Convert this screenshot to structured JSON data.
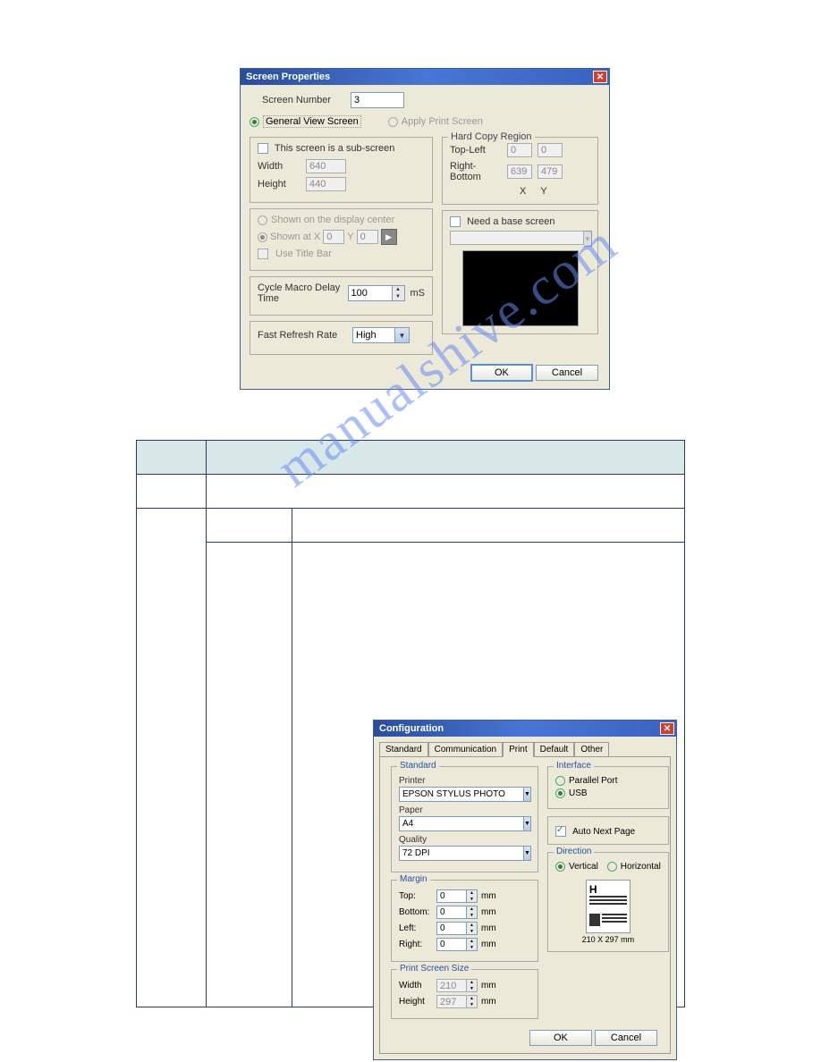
{
  "dialog1": {
    "title": "Screen Properties",
    "screen_number_label": "Screen Number",
    "screen_number_value": "3",
    "radio_general": "General View Screen",
    "radio_apply": "Apply Print Screen",
    "sub_screen_label": "This screen is a sub-screen",
    "width_label": "Width",
    "width_value": "640",
    "height_label": "Height",
    "height_value": "440",
    "shown_center_label": "Shown on the display center",
    "shown_at_label": "Shown at",
    "shown_x_label": "X",
    "shown_x_value": "0",
    "shown_y_label": "Y",
    "shown_y_value": "0",
    "use_titlebar_label": "Use Title Bar",
    "cycle_macro_label": "Cycle Macro Delay Time",
    "cycle_macro_value": "100",
    "cycle_macro_unit": "mS",
    "fast_refresh_label": "Fast Refresh Rate",
    "fast_refresh_value": "High",
    "hard_copy_legend": "Hard Copy Region",
    "top_left_label": "Top-Left",
    "top_left_x": "0",
    "top_left_y": "0",
    "right_bottom_label": "Right-Bottom",
    "right_bottom_x": "639",
    "right_bottom_y": "479",
    "x_hdr": "X",
    "y_hdr": "Y",
    "need_base_label": "Need a base screen",
    "ok": "OK",
    "cancel": "Cancel"
  },
  "dialog2": {
    "title": "Configuration",
    "tabs": [
      "Standard",
      "Communication",
      "Print",
      "Default",
      "Other"
    ],
    "standard_legend": "Standard",
    "printer_label": "Printer",
    "printer_value": "EPSON STYLUS PHOTO",
    "paper_label": "Paper",
    "paper_value": "A4",
    "quality_label": "Quality",
    "quality_value": "72 DPI",
    "margin_legend": "Margin",
    "top_label": "Top:",
    "bottom_label": "Bottom:",
    "left_label": "Left:",
    "right_label": "Right:",
    "margin_top": "0",
    "margin_bottom": "0",
    "margin_left": "0",
    "margin_right": "0",
    "unit": "mm",
    "pss_legend": "Print Screen Size",
    "pss_width_label": "Width",
    "pss_width_value": "210",
    "pss_height_label": "Height",
    "pss_height_value": "297",
    "interface_legend": "Interface",
    "parallel_label": "Parallel Port",
    "usb_label": "USB",
    "auto_next_label": "Auto Next Page",
    "direction_legend": "Direction",
    "vertical_label": "Vertical",
    "horizontal_label": "Horizontal",
    "dim_text": "210 X 297 mm",
    "ok": "OK",
    "cancel": "Cancel"
  },
  "watermark": "manualshive.com"
}
